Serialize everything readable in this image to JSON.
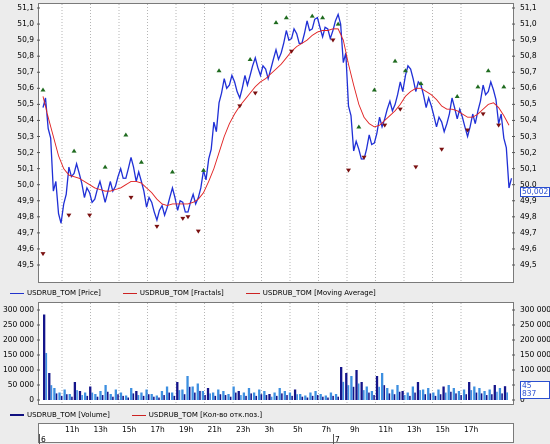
{
  "price_panel": {
    "y_ticks": [
      "51,1",
      "51,0",
      "50,9",
      "50,8",
      "50,7",
      "50,6",
      "50,5",
      "50,4",
      "50,3",
      "50,2",
      "50,1",
      "50,0",
      "49,9",
      "49,8",
      "49,7",
      "49,6",
      "49,5"
    ],
    "last_value": "50,002",
    "legend": [
      {
        "label": "USDRUB_TOM [Price]",
        "color": "#2233cc"
      },
      {
        "label": "USDRUB_TOM [Fractals]",
        "color": "#cc2222"
      },
      {
        "label": "USDRUB_TOM [Moving Average]",
        "color": "#cc2222"
      }
    ],
    "colors": {
      "price": "#1f2fd6",
      "ma": "#e02020",
      "fractal_up": "#1f6b1f",
      "fractal_down": "#7a1010"
    }
  },
  "volume_panel": {
    "y_ticks": [
      "300 000",
      "250 000",
      "200 000",
      "150 000",
      "100 000",
      "50 000",
      "0"
    ],
    "last_value": "45 837",
    "legend": [
      {
        "label": "USDRUB_TOM [Volume]",
        "color": "#101080"
      },
      {
        "label": "USDRUB_TOM [Кол-во отк.поз.]",
        "color": "#cc2222"
      }
    ],
    "colors": {
      "dark": "#14148a",
      "light": "#3d8fe0"
    }
  },
  "time_axis": {
    "hours": [
      "11h",
      "13h",
      "15h",
      "17h",
      "19h",
      "21h",
      "23h",
      "3h",
      "5h",
      "7h",
      "9h",
      "11h",
      "13h",
      "15h",
      "17h"
    ],
    "days": [
      "6",
      "7"
    ]
  },
  "chart_data": {
    "type": "line",
    "ylim": [
      49.5,
      51.1
    ],
    "price": [
      50.52,
      50.31,
      50.0,
      49.78,
      49.92,
      50.07,
      50.11,
      50.03,
      49.96,
      49.91,
      49.95,
      49.98,
      49.93,
      49.98,
      50.03,
      50.06,
      50.08,
      50.13,
      50.06,
      49.98,
      49.9,
      49.85,
      49.82,
      49.83,
      49.9,
      49.94,
      49.88,
      49.85,
      49.87,
      49.9,
      49.96,
      50.05,
      50.2,
      50.35,
      50.55,
      50.62,
      50.66,
      50.6,
      50.58,
      50.64,
      50.72,
      50.75,
      50.72,
      50.68,
      50.76,
      50.8,
      50.86,
      50.92,
      50.95,
      50.9,
      50.92,
      50.98,
      51.01,
      51.0,
      50.96,
      50.93,
      51.0,
      51.02,
      50.8,
      50.45,
      50.25,
      50.18,
      50.2,
      50.27,
      50.3,
      50.38,
      50.45,
      50.48,
      50.54,
      50.6,
      50.72,
      50.68,
      50.62,
      50.58,
      50.52,
      50.45,
      50.4,
      50.35,
      50.42,
      50.5,
      50.45,
      50.38,
      50.34,
      50.4,
      50.5,
      50.58,
      50.62,
      50.55,
      50.42,
      50.25,
      50.02
    ],
    "ma": [
      50.55,
      50.42,
      50.3,
      50.18,
      50.1,
      50.06,
      50.05,
      50.04,
      50.02,
      50.0,
      49.98,
      49.97,
      49.96,
      49.96,
      49.97,
      49.98,
      50.0,
      50.02,
      50.02,
      50.01,
      49.98,
      49.95,
      49.91,
      49.88,
      49.87,
      49.88,
      49.88,
      49.88,
      49.88,
      49.89,
      49.91,
      49.95,
      50.02,
      50.1,
      50.2,
      50.3,
      50.38,
      50.44,
      50.49,
      50.53,
      50.57,
      50.61,
      50.64,
      50.66,
      50.69,
      50.72,
      50.75,
      50.79,
      50.83,
      50.86,
      50.88,
      50.9,
      50.93,
      50.95,
      50.96,
      50.96,
      50.97,
      50.97,
      50.9,
      50.75,
      50.62,
      50.5,
      50.42,
      50.38,
      50.36,
      50.37,
      50.4,
      50.43,
      50.46,
      50.5,
      50.55,
      50.58,
      50.6,
      50.6,
      50.58,
      50.56,
      50.53,
      50.49,
      50.47,
      50.47,
      50.46,
      50.44,
      50.42,
      50.42,
      50.44,
      50.47,
      50.5,
      50.51,
      50.48,
      50.43,
      50.37
    ],
    "fractals_up": [
      [
        0,
        50.58
      ],
      [
        6,
        50.2
      ],
      [
        12,
        50.1
      ],
      [
        16,
        50.3
      ],
      [
        19,
        50.13
      ],
      [
        25,
        50.07
      ],
      [
        31,
        50.08
      ],
      [
        34,
        50.7
      ],
      [
        40,
        50.77
      ],
      [
        45,
        51.0
      ],
      [
        47,
        51.03
      ],
      [
        52,
        51.04
      ],
      [
        54,
        51.03
      ],
      [
        57,
        50.99
      ],
      [
        61,
        50.35
      ],
      [
        64,
        50.58
      ],
      [
        68,
        50.76
      ],
      [
        70,
        50.7
      ],
      [
        73,
        50.62
      ],
      [
        80,
        50.54
      ],
      [
        84,
        50.6
      ],
      [
        86,
        50.7
      ],
      [
        89,
        50.6
      ]
    ],
    "fractals_down": [
      [
        0,
        49.58
      ],
      [
        5,
        49.82
      ],
      [
        9,
        49.82
      ],
      [
        17,
        49.93
      ],
      [
        22,
        49.75
      ],
      [
        27,
        49.8
      ],
      [
        28,
        49.81
      ],
      [
        30,
        49.72
      ],
      [
        38,
        50.5
      ],
      [
        41,
        50.58
      ],
      [
        48,
        50.84
      ],
      [
        56,
        50.91
      ],
      [
        59,
        50.1
      ],
      [
        62,
        50.18
      ],
      [
        66,
        50.38
      ],
      [
        69,
        50.48
      ],
      [
        72,
        50.12
      ],
      [
        77,
        50.23
      ],
      [
        82,
        50.35
      ],
      [
        85,
        50.45
      ],
      [
        88,
        50.38
      ]
    ],
    "volume": [
      285000,
      90000,
      40000,
      25000,
      35000,
      20000,
      60000,
      30000,
      25000,
      45000,
      20000,
      30000,
      50000,
      20000,
      35000,
      25000,
      15000,
      40000,
      30000,
      25000,
      35000,
      20000,
      15000,
      30000,
      45000,
      25000,
      60000,
      35000,
      80000,
      45000,
      55000,
      30000,
      40000,
      25000,
      35000,
      30000,
      20000,
      45000,
      30000,
      25000,
      40000,
      25000,
      35000,
      30000,
      20000,
      25000,
      40000,
      30000,
      25000,
      35000,
      20000,
      15000,
      25000,
      30000,
      20000,
      15000,
      25000,
      20000,
      110000,
      90000,
      80000,
      100000,
      60000,
      45000,
      30000,
      80000,
      90000,
      40000,
      35000,
      50000,
      30000,
      25000,
      45000,
      60000,
      35000,
      40000,
      25000,
      35000,
      45000,
      50000,
      40000,
      30000,
      35000,
      60000,
      45000,
      40000,
      30000,
      35000,
      50000,
      40000,
      46000
    ],
    "volume_dark": [
      0,
      1,
      6,
      7,
      9,
      18,
      26,
      32,
      38,
      44,
      49,
      58,
      59,
      61,
      62,
      65,
      70,
      73,
      78,
      83,
      88,
      90
    ]
  }
}
